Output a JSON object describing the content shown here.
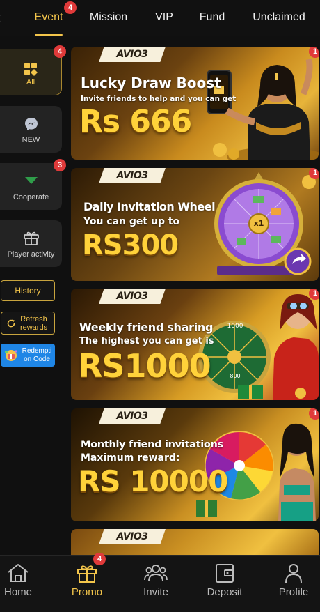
{
  "tabs": [
    {
      "label": "Event",
      "badge": "4",
      "active": true
    },
    {
      "label": "Mission"
    },
    {
      "label": "VIP"
    },
    {
      "label": "Fund"
    },
    {
      "label": "Unclaimed"
    }
  ],
  "sidebar": {
    "items": [
      {
        "label": "All",
        "badge": "4",
        "icon": "grid-icon",
        "active": true
      },
      {
        "label": "NEW",
        "icon": "messenger-icon"
      },
      {
        "label": "Cooperate",
        "badge": "3",
        "icon": "arrow-down-icon"
      },
      {
        "label": "Player activity",
        "icon": "gift-icon"
      }
    ],
    "history_label": "History",
    "refresh_label": "Refresh rewards",
    "redeem_label": "Redempti on Code"
  },
  "banners": [
    {
      "logo": "AVIO3",
      "title": "Lucky Draw Boost",
      "subtitle": "Invite friends to help and you can get",
      "amount": "Rs 666",
      "badge": "1"
    },
    {
      "logo": "AVIO3",
      "title": "Daily Invitation Wheel",
      "subtitle": "You can get up to",
      "amount": "RS300",
      "badge": "1",
      "wheel_center": "x1"
    },
    {
      "logo": "AVIO3",
      "title": "Weekly friend sharing",
      "subtitle": "The highest you can get is",
      "amount": "RS1000",
      "badge": "1",
      "wheel_top": "1000",
      "wheel_bottom": "800"
    },
    {
      "logo": "AVIO3",
      "title": "Monthly friend invitations",
      "subtitle": "Maximum reward:",
      "amount": "RS 10000",
      "badge": "1"
    },
    {
      "logo": "AVIO3"
    }
  ],
  "bottom_nav": [
    {
      "label": "Home",
      "icon": "home-icon"
    },
    {
      "label": "Promo",
      "icon": "gift-icon",
      "badge": "4",
      "active": true
    },
    {
      "label": "Invite",
      "icon": "users-icon"
    },
    {
      "label": "Deposit",
      "icon": "wallet-icon"
    },
    {
      "label": "Profile",
      "icon": "person-icon"
    }
  ],
  "colors": {
    "accent": "#f3c54b",
    "badge": "#e03a3a",
    "background": "#101010"
  }
}
